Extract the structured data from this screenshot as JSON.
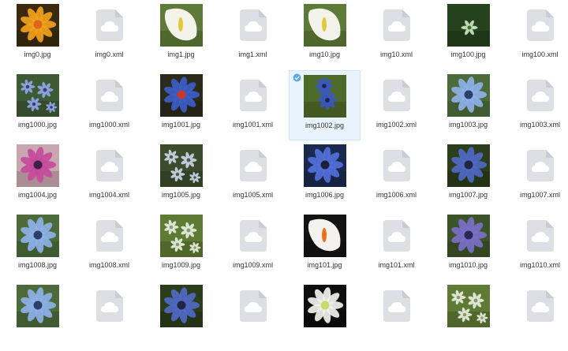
{
  "colors": {
    "selection_bg": "#e8f3fd",
    "doc_icon": "#dddfe4",
    "cloud": "#ffffff",
    "label_text": "#333333"
  },
  "files": [
    {
      "name": "img0.jpg",
      "type": "image",
      "palette": "orange"
    },
    {
      "name": "img0.xml",
      "type": "xml",
      "icon": "cloud-file-icon"
    },
    {
      "name": "img1.jpg",
      "type": "image",
      "palette": "calla"
    },
    {
      "name": "img1.xml",
      "type": "xml",
      "icon": "cloud-file-icon"
    },
    {
      "name": "img10.jpg",
      "type": "image",
      "palette": "calla"
    },
    {
      "name": "img10.xml",
      "type": "xml",
      "icon": "cloud-file-icon"
    },
    {
      "name": "img100.jpg",
      "type": "image",
      "palette": "green"
    },
    {
      "name": "img100.xml",
      "type": "xml",
      "icon": "cloud-file-icon"
    },
    {
      "name": "img1000.jpg",
      "type": "image",
      "palette": "bluesmall"
    },
    {
      "name": "img1000.xml",
      "type": "xml",
      "icon": "cloud-file-icon"
    },
    {
      "name": "img1001.jpg",
      "type": "image",
      "palette": "bluered"
    },
    {
      "name": "img1001.xml",
      "type": "xml",
      "icon": "cloud-file-icon"
    },
    {
      "name": "img1002.jpg",
      "type": "image",
      "palette": "bluegreen",
      "selected": true
    },
    {
      "name": "img1002.xml",
      "type": "xml",
      "icon": "cloud-file-icon"
    },
    {
      "name": "img1003.jpg",
      "type": "image",
      "palette": "bluelight"
    },
    {
      "name": "img1003.xml",
      "type": "xml",
      "icon": "cloud-file-icon"
    },
    {
      "name": "img1004.jpg",
      "type": "image",
      "palette": "pink"
    },
    {
      "name": "img1004.xml",
      "type": "xml",
      "icon": "cloud-file-icon"
    },
    {
      "name": "img1005.jpg",
      "type": "image",
      "palette": "greensmall"
    },
    {
      "name": "img1005.xml",
      "type": "xml",
      "icon": "cloud-file-icon"
    },
    {
      "name": "img1006.jpg",
      "type": "image",
      "palette": "bluebig"
    },
    {
      "name": "img1006.xml",
      "type": "xml",
      "icon": "cloud-file-icon"
    },
    {
      "name": "img1007.jpg",
      "type": "image",
      "palette": "bluedark"
    },
    {
      "name": "img1007.xml",
      "type": "xml",
      "icon": "cloud-file-icon"
    },
    {
      "name": "img1008.jpg",
      "type": "image",
      "palette": "bluelight"
    },
    {
      "name": "img1008.xml",
      "type": "xml",
      "icon": "cloud-file-icon"
    },
    {
      "name": "img1009.jpg",
      "type": "image",
      "palette": "greenwhite"
    },
    {
      "name": "img1009.xml",
      "type": "xml",
      "icon": "cloud-file-icon"
    },
    {
      "name": "img101.jpg",
      "type": "image",
      "palette": "callaorange"
    },
    {
      "name": "img101.xml",
      "type": "xml",
      "icon": "cloud-file-icon"
    },
    {
      "name": "img1010.jpg",
      "type": "image",
      "palette": "purple"
    },
    {
      "name": "img1010.xml",
      "type": "xml",
      "icon": "cloud-file-icon"
    },
    {
      "name": "",
      "type": "image",
      "palette": "bluelight"
    },
    {
      "name": "",
      "type": "xml",
      "icon": "cloud-file-icon"
    },
    {
      "name": "",
      "type": "image",
      "palette": "bluedark"
    },
    {
      "name": "",
      "type": "xml",
      "icon": "cloud-file-icon"
    },
    {
      "name": "",
      "type": "image",
      "palette": "white"
    },
    {
      "name": "",
      "type": "xml",
      "icon": "cloud-file-icon"
    },
    {
      "name": "",
      "type": "image",
      "palette": "greenwhite"
    },
    {
      "name": "",
      "type": "xml",
      "icon": "cloud-file-icon"
    }
  ]
}
